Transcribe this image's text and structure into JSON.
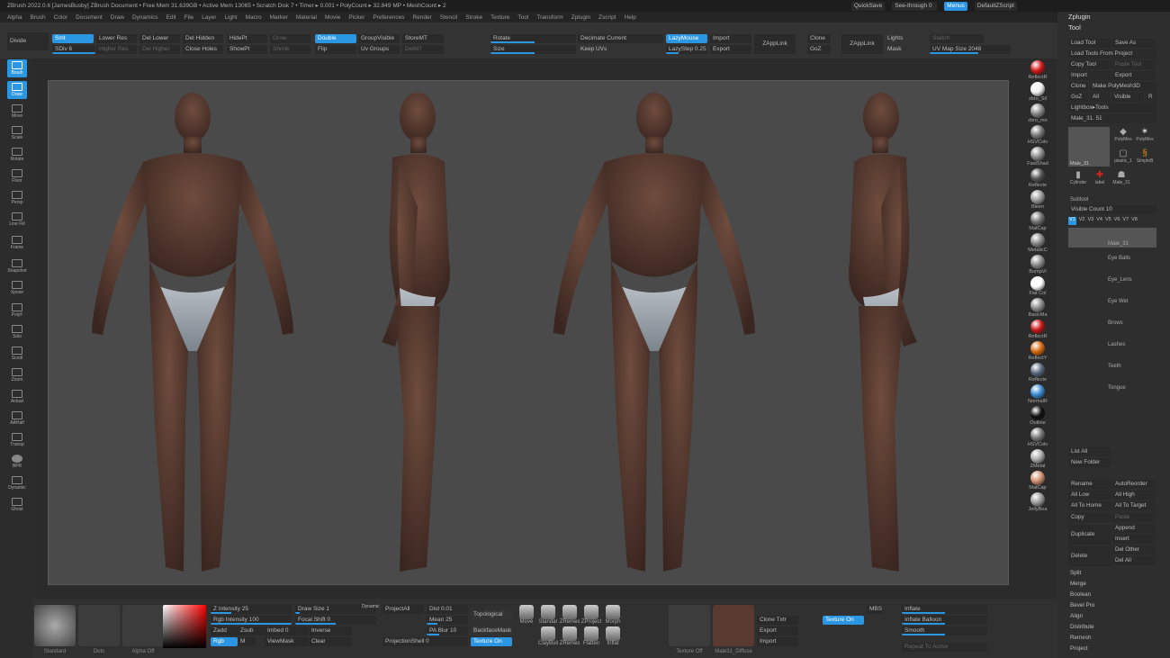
{
  "titlebar": {
    "text": "ZBrush 2022.0.6 [JamesBusby] ZBrush Document  • Free Mem 31.639GB • Active Mem 13065 • Scratch Disk 7 • Timer ▸ 0.001 • PolyCount ▸ 32.849 MP • MeshCount ▸ 2",
    "quicksave": "QuickSave",
    "seethrough": "See-through  0",
    "menus": "Menus",
    "defaultzscript": "DefaultZScript"
  },
  "menu": [
    "Alpha",
    "Brush",
    "Color",
    "Document",
    "Draw",
    "Dynamics",
    "Edit",
    "File",
    "Layer",
    "Light",
    "Macro",
    "Marker",
    "Material",
    "Movie",
    "Picker",
    "Preferences",
    "Render",
    "Stencil",
    "Stroke",
    "Texture",
    "Tool",
    "Transform",
    "Zplugin",
    "Zscript",
    "Help"
  ],
  "topshelf": {
    "divide": "Divide",
    "smt": "Smt",
    "sdiv": "SDiv 6",
    "lower_res": "Lower Res",
    "higher_res": "Higher Res",
    "del_lower": "Del Lower",
    "del_higher": "Del Higher",
    "del_hidden": "Del Hidden",
    "close_holes": "Close Holes",
    "hidept": "HidePt",
    "showpt": "ShowPt",
    "grow": "Grow",
    "shrink": "Shrink",
    "double": "Double",
    "flip": "Flip",
    "groupvisible": "GroupVisible",
    "uv_groups": "Uv Groups",
    "storemt": "StoreMT",
    "delmt": "DelMT",
    "rotate": "Rotate",
    "size": "Size",
    "decimate_current": "Decimate Current",
    "keep_uvs": "Keep UVs",
    "lazymouse": "LazyMouse",
    "lazystep": "LazyStep 0.25",
    "import": "Import",
    "export": "Export",
    "zapplink": "ZAppLink",
    "clone": "Clone",
    "goz": "GoZ",
    "zapplink2": "ZAppLink",
    "lights": "Lights",
    "mask": "Mask",
    "switch": "Switch",
    "uv_map_size": "UV Map Size 2048"
  },
  "lefttray": [
    "Brush",
    "Draw",
    "Move",
    "Scale",
    "Rotate",
    "Floor",
    "Persp",
    "Line Fill",
    "Frame",
    "Snapshot",
    "Xpose",
    "PolyF",
    "Solo",
    "Scroll",
    "Zoom",
    "Actual",
    "AAHalf",
    "Transp",
    "BPR",
    "Dynamic",
    "Ghost"
  ],
  "materials": [
    {
      "label": "ReflectR",
      "color": "#d21a1a"
    },
    {
      "label": "zbro_Sil",
      "color": "#f0f0f0"
    },
    {
      "label": "zbro_mo",
      "color": "#888888"
    },
    {
      "label": "HSVColo",
      "color": "#777777"
    },
    {
      "label": "FastShad",
      "color": "#8a8a8a"
    },
    {
      "label": "Reflecte",
      "color": "#555555"
    },
    {
      "label": "Bleen",
      "color": "#9a9a9a"
    },
    {
      "label": "MatCap",
      "color": "#707070"
    },
    {
      "label": "MetalicC",
      "color": "#888888"
    },
    {
      "label": "BumpVi",
      "color": "#8a8a8a"
    },
    {
      "label": "Flat Col",
      "color": "#ffffff"
    },
    {
      "label": "BasicMa",
      "color": "#8a8a8a"
    },
    {
      "label": "ReflectR",
      "color": "#c81818"
    },
    {
      "label": "ReflectY",
      "color": "#d86a10"
    },
    {
      "label": "Reflecte",
      "color": "#5a6a80"
    },
    {
      "label": "NormalR",
      "color": "#3a8ad0"
    },
    {
      "label": "Outline",
      "color": "#111111"
    },
    {
      "label": "HSVColo",
      "color": "#777777"
    },
    {
      "label": "ZMetal",
      "color": "#aaaaaa"
    },
    {
      "label": "MatCap",
      "color": "#d09070"
    },
    {
      "label": "JellyBea",
      "color": "#999999"
    }
  ],
  "rightpanel": {
    "zplugin": "Zplugin",
    "tool": "Tool",
    "load_tool": "Load Tool",
    "save_as": "Save As",
    "load_tools_from_project": "Load Tools From Project",
    "copy_tool": "Copy Tool",
    "paste_tool": "Paste Tool",
    "import": "Import",
    "export": "Export",
    "clone": "Clone",
    "make_polymesh3d": "Make PolyMesh3D",
    "goz": "GoZ",
    "all": "All",
    "visible": "Visible",
    "r": "R",
    "lightbox_tools": "Lightbox▸Tools",
    "male_slider": "Male_31. 51",
    "thumbs": [
      "Male_31",
      "PolyMes",
      "PolyMes",
      "plastic_1",
      "SimpleB",
      "Cylinder",
      "label",
      "Male_31"
    ],
    "subtool": "Subtool",
    "visible_count": "Visible Count 10",
    "versions": [
      "V1",
      "V2",
      "V3",
      "V4",
      "V5",
      "V6",
      "V7",
      "V8"
    ],
    "subtools": [
      "Male_31",
      "Eye Balls",
      "Eye_Lens",
      "Eye Wet",
      "Brows",
      "Lashes",
      "Teeth",
      "Tongue"
    ],
    "list_all": "List All",
    "new_folder": "New Folder",
    "rename": "Rename",
    "autoreorder": "AutoReorder",
    "all_low": "All Low",
    "all_high": "All High",
    "all_to_home": "All To Home",
    "all_to_target": "All To Target",
    "copy": "Copy",
    "paste": "Paste",
    "append": "Append",
    "duplicate": "Duplicate",
    "insert": "Insert",
    "del_other": "Del Other",
    "delete": "Delete",
    "del_all": "Del All",
    "menu_items": [
      "Split",
      "Merge",
      "Boolean",
      "Bevel Pro",
      "Align",
      "Distribute",
      "Remesh",
      "Project"
    ]
  },
  "bottom": {
    "standard": "Standard",
    "dots": "Dots",
    "alpha_off": "Alpha Off",
    "z_intensity": "Z Intensity 25",
    "rgb_intensity": "Rgb Intensity 100",
    "zadd": "Zadd",
    "zsub": "Zsub",
    "rgb": "Rgb",
    "m": "M",
    "draw_size": "Draw Size 1",
    "dynamic": "Dynamic",
    "focal_shift": "Focal Shift 0",
    "imbed": "Imbed 0",
    "inverse": "Inverse",
    "viewmask": "ViewMask",
    "clear": "Clear",
    "projectall": "ProjectAll",
    "dist": "Dist 0.01",
    "mean": "Mean 25",
    "pa_blur": "PA Blur 10",
    "projectionshell": "ProjectionShell 0",
    "topological": "Topological",
    "backfacemask": "BackfaceMask",
    "texture_on": "Texture On",
    "brushes": [
      "Move",
      "Standar",
      "ZRemes",
      "ZProject",
      "Morph",
      "ClayBuil",
      "ZRemes",
      "Flatten",
      "Inflat"
    ],
    "texture_off": "Texture Off",
    "male_diffuse": "Male31_Diffuse",
    "clone_txtr": "Clone Txtr",
    "export": "Export",
    "import": "Import",
    "texture_on2": "Texture On",
    "mbs": "MBS",
    "inflate": "Inflate",
    "inflate_balloon": "Inflate Balloon",
    "smooth": "Smooth",
    "repeat_to_active": "Repeat To Active"
  }
}
